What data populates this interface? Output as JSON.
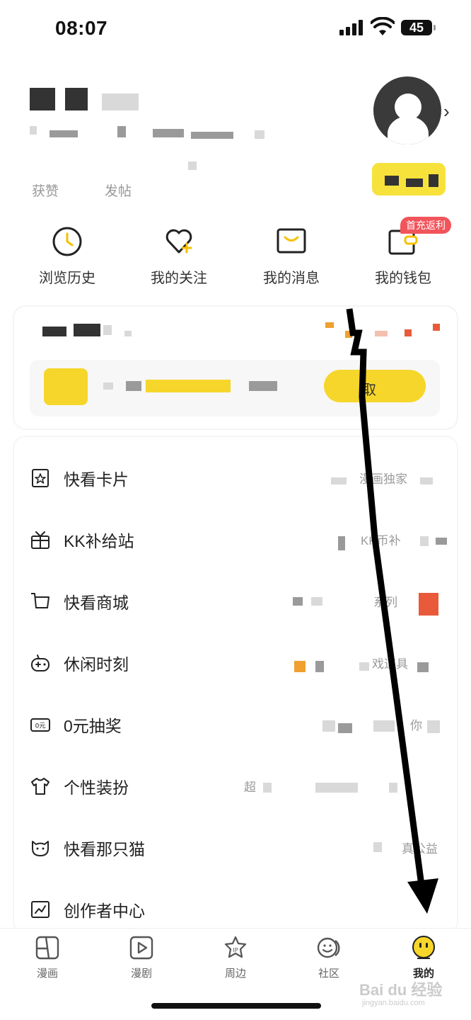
{
  "status_bar": {
    "time": "08:07",
    "battery": "45"
  },
  "profile": {
    "stats": [
      {
        "label": "获赞"
      },
      {
        "label": "发帖"
      }
    ]
  },
  "quick_actions": [
    {
      "label": "浏览历史",
      "icon": "clock-icon"
    },
    {
      "label": "我的关注",
      "icon": "heart-plus-icon"
    },
    {
      "label": "我的消息",
      "icon": "message-icon"
    },
    {
      "label": "我的钱包",
      "icon": "wallet-icon",
      "badge": "首充返利"
    }
  ],
  "vip_card": {
    "button_partial": "取"
  },
  "menu": [
    {
      "label": "快看卡片",
      "note": "漫画独家",
      "icon": "card-icon"
    },
    {
      "label": "KK补给站",
      "note": "KK币补",
      "icon": "gift-icon"
    },
    {
      "label": "快看商城",
      "note": "系列",
      "icon": "cart-icon"
    },
    {
      "label": "休闲时刻",
      "note": "戏道具",
      "icon": "gamepad-icon"
    },
    {
      "label": "0元抽奖",
      "note": "你",
      "icon": "lottery-icon"
    },
    {
      "label": "个性装扮",
      "note": "超",
      "icon": "tshirt-icon"
    },
    {
      "label": "快看那只猫",
      "note": "真公益",
      "icon": "cat-icon"
    },
    {
      "label": "创作者中心",
      "note": "",
      "icon": "chart-icon"
    }
  ],
  "tabs": [
    {
      "label": "漫画",
      "icon": "comic-icon",
      "active": false
    },
    {
      "label": "漫剧",
      "icon": "play-icon",
      "active": false
    },
    {
      "label": "周边",
      "icon": "ip-icon",
      "active": false
    },
    {
      "label": "社区",
      "icon": "community-icon",
      "active": false
    },
    {
      "label": "我的",
      "icon": "mine-icon",
      "active": true
    }
  ],
  "watermark": {
    "brand": "Bai du 经验",
    "url": "jingyan.baidu.com"
  },
  "colors": {
    "brand_yellow": "#f6d62a",
    "badge_red": "#f2545b",
    "text_gray": "#9a9a9a"
  }
}
